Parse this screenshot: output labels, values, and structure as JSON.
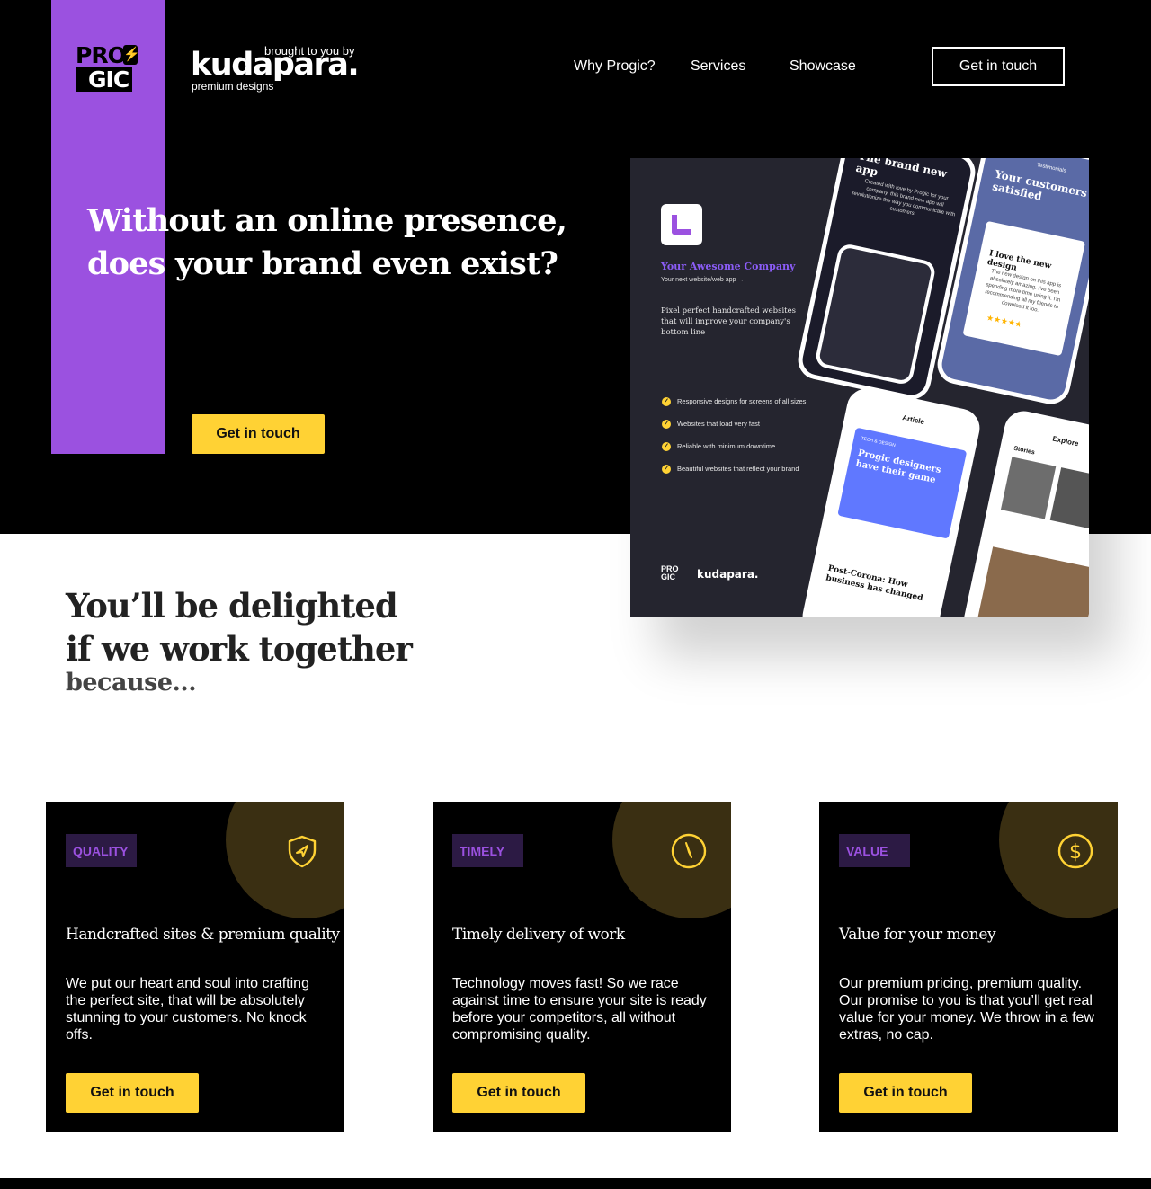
{
  "header": {
    "logo": {
      "line1": "PRO",
      "line2": "GIC"
    },
    "brand": {
      "top": "brought to you by",
      "main": "kudapara.",
      "sub": "premium designs"
    },
    "nav": [
      "Why Progic?",
      "Services",
      "Showcase"
    ],
    "cta": "Get in touch"
  },
  "hero": {
    "title_line1": "Without an online presence,",
    "title_line2": "does your brand even exist?",
    "cta": "Get in touch"
  },
  "mockup": {
    "company": "Your Awesome Company",
    "subtitle": "Your next website/web app →",
    "description": "Pixel perfect handcrafted websites that will improve your company's bottom line",
    "features": [
      "Responsive designs for screens of all sizes",
      "Websites that load very fast",
      "Reliable  with minimum downtime",
      "Beautiful websites that reflect your brand"
    ],
    "footer_logo_line1": "PRO",
    "footer_logo_line2": "GIC",
    "footer_brand": "kudapara.",
    "phone1": {
      "title": "The brand new app",
      "text": "Created with love by Progic for your company, this brand new app will revolutionize the way you communicate with customers"
    },
    "phone2": {
      "label": "Testimonials",
      "title": "Your customers satisfied",
      "card_title": "I love the new design",
      "card_text": "The new design on this app is absolutely amazing. I've been spending more time using it. I'm recommending all my friends to download it too.",
      "stars": "★★★★★"
    },
    "phone3": {
      "header": "Article",
      "tag": "TECH & DESIGN",
      "title": "Progic designers have their game",
      "post": "Post-Corona: How business has changed"
    },
    "phone4": {
      "title": "Explore",
      "section": "Stories"
    }
  },
  "section": {
    "title_line1": "You’ll be delighted",
    "title_line2": "if we  work together",
    "subtitle": "because..."
  },
  "cards": [
    {
      "badge": "QUALITY",
      "icon": "shield-icon",
      "title": "Handcrafted sites & premium quality",
      "text": "We put our heart and soul into crafting the perfect site, that will be absolutely stunning to your customers. No knock offs.",
      "cta": "Get in touch"
    },
    {
      "badge": "TIMELY",
      "icon": "compass-icon",
      "title": "Timely delivery of work",
      "text": "Technology moves fast! So we race against time to ensure your site is ready before your competitors, all without compromising quality.",
      "cta": "Get in touch"
    },
    {
      "badge": "VALUE",
      "icon": "dollar-icon",
      "title": "Value for your money",
      "text": "Our premium pricing, premium quality. Our promise to you is that you’ll get real value for your money. We throw in a few extras, no cap.",
      "cta": "Get in touch"
    }
  ],
  "colors": {
    "purple": "#9b51e0",
    "yellow": "#ffd234",
    "black": "#000000"
  }
}
